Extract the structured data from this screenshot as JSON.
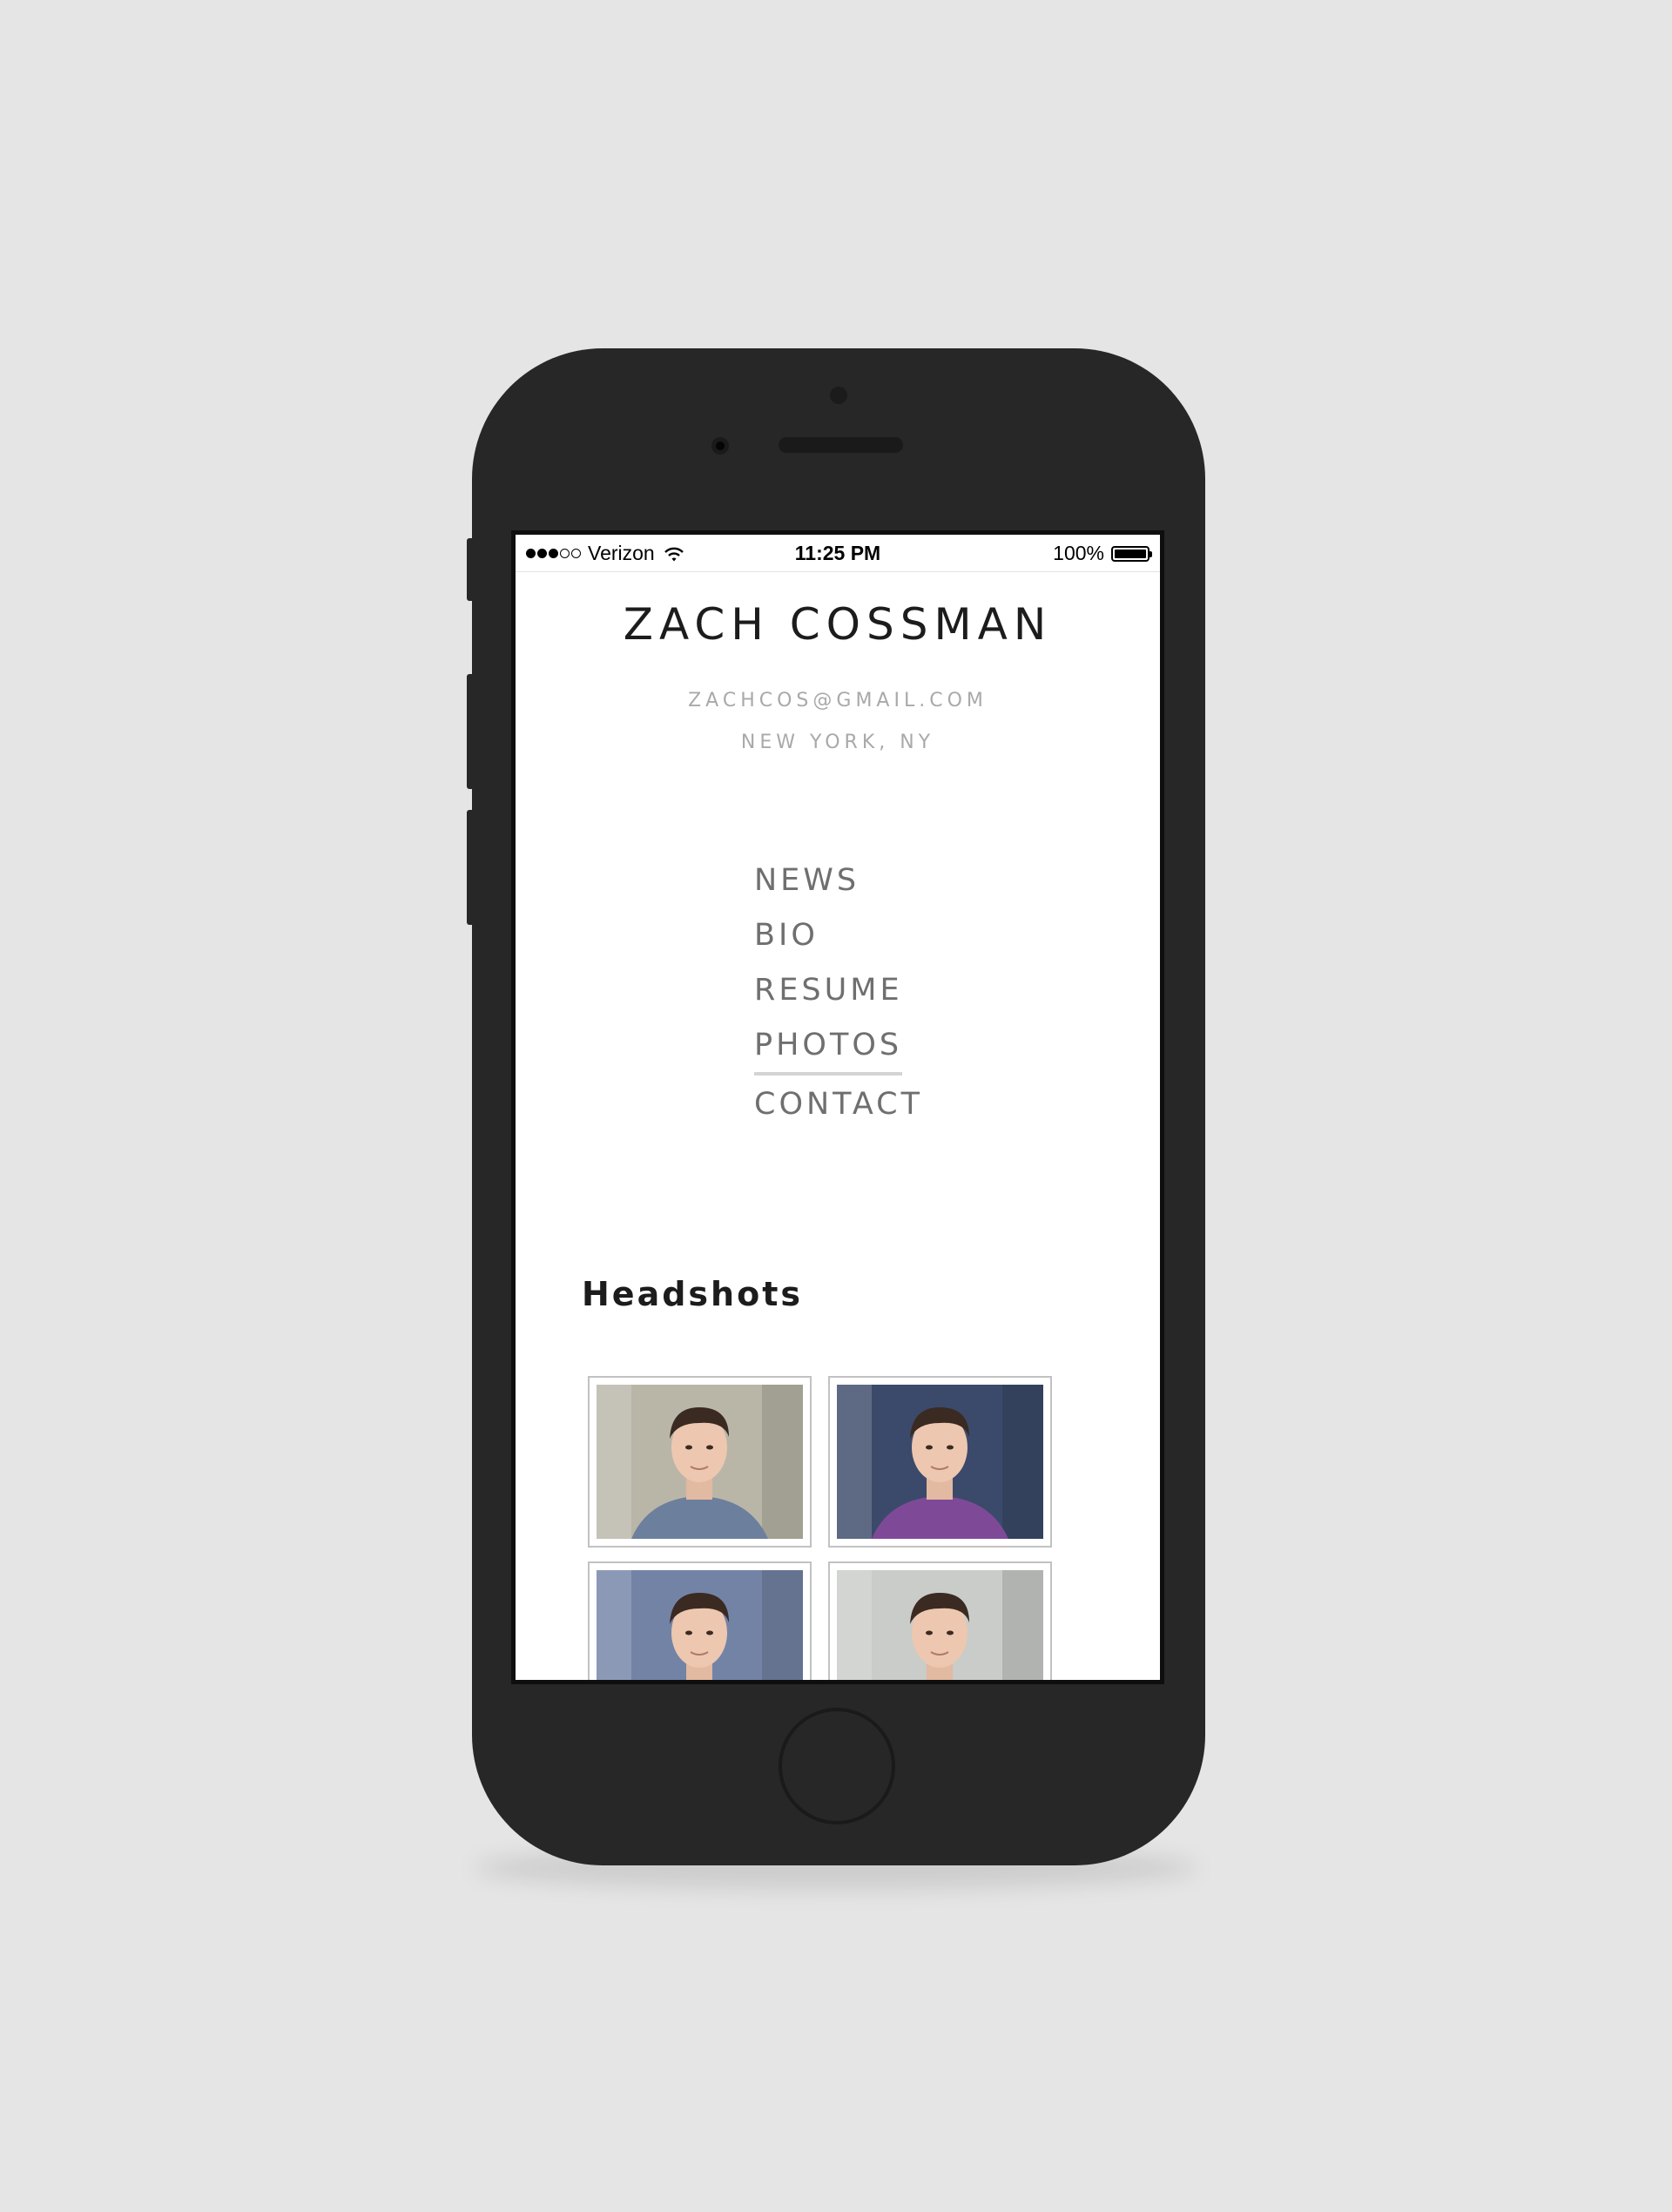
{
  "status_bar": {
    "carrier": "Verizon",
    "time": "11:25 PM",
    "battery": "100%",
    "signal_bars_filled": 3,
    "signal_bars_total": 5
  },
  "site": {
    "title": "ZACH COSSMAN",
    "email": "ZACHCOS@GMAIL.COM",
    "location": "NEW YORK, NY"
  },
  "nav": {
    "items": [
      {
        "label": "NEWS"
      },
      {
        "label": "BIO"
      },
      {
        "label": "RESUME"
      },
      {
        "label": "PHOTOS",
        "active": true
      },
      {
        "label": "CONTACT"
      }
    ]
  },
  "main": {
    "section_title": "Headshots",
    "headshots": [
      {
        "name": "headshot-1",
        "bg": "#b9b6a8",
        "shirt": "#6c7f9c"
      },
      {
        "name": "headshot-2",
        "bg": "#3b4a6a",
        "shirt": "#7e4a98"
      },
      {
        "name": "headshot-3",
        "bg": "#7383a6",
        "shirt": "#5d6b8c"
      },
      {
        "name": "headshot-4",
        "bg": "#c9ccc9",
        "shirt": "#2e2e2e"
      }
    ]
  }
}
